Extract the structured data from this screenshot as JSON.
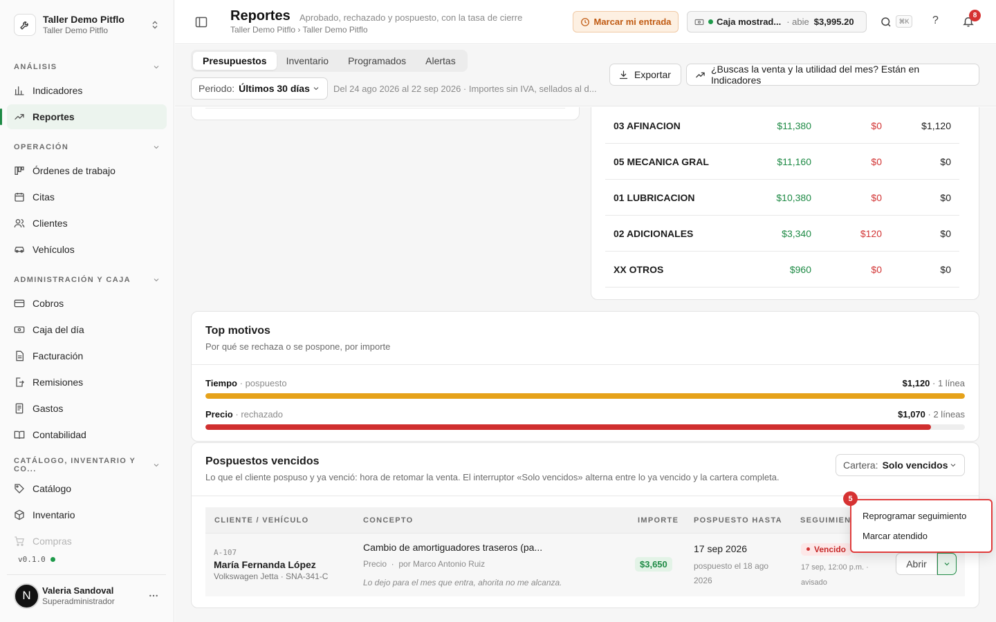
{
  "workspace": {
    "title": "Taller Demo Pitflo",
    "subtitle": "Taller Demo Pitflo"
  },
  "sidebar": {
    "sections": {
      "analisis": "ANÁLISIS",
      "operacion": "OPERACIÓN",
      "administracion": "ADMINISTRACIÓN Y CAJA",
      "catalogo": "CATÁLOGO, INVENTARIO Y CO..."
    },
    "items": {
      "indicadores": "Indicadores",
      "reportes": "Reportes",
      "ordenes": "Órdenes de trabajo",
      "citas": "Citas",
      "clientes": "Clientes",
      "vehiculos": "Vehículos",
      "cobros": "Cobros",
      "caja": "Caja del día",
      "facturacion": "Facturación",
      "remisiones": "Remisiones",
      "gastos": "Gastos",
      "contabilidad": "Contabilidad",
      "catalogo": "Catálogo",
      "inventario": "Inventario",
      "compras": "Compras"
    },
    "version": "v0.1.0",
    "user": {
      "initial": "N",
      "name": "Valeria Sandoval",
      "role": "Superadministrador"
    }
  },
  "header": {
    "title": "Reportes",
    "description": "Aprobado, rechazado y pospuesto, con la tasa de cierre",
    "breadcrumb": "Taller Demo Pitflo › Taller Demo Pitflo",
    "entrada_label": "Marcar mi entrada",
    "caja": {
      "name": "Caja mostrad...",
      "status": "abie",
      "amount": "$3,995.20"
    },
    "shortcut": "⌘K",
    "help": "?",
    "notifications": "8"
  },
  "toolbar": {
    "tabs": [
      "Presupuestos",
      "Inventario",
      "Programados",
      "Alertas"
    ],
    "periodo_label": "Periodo:",
    "periodo_value": "Últimos 30 días",
    "rango": "Del 24 ago 2026 al 22 sep 2026 · Importes sin IVA, sellados al d...",
    "exportar": "Exportar",
    "indicadores_hint": "¿Buscas la venta y la utilidad del mes? Están en Indicadores"
  },
  "categorias": [
    {
      "name": "03 AFINACION",
      "aprobado": "$11,380",
      "rechazado": "$0",
      "pospuesto": "$1,120"
    },
    {
      "name": "05 MECANICA GRAL",
      "aprobado": "$11,160",
      "rechazado": "$0",
      "pospuesto": "$0"
    },
    {
      "name": "01 LUBRICACION",
      "aprobado": "$10,380",
      "rechazado": "$0",
      "pospuesto": "$0"
    },
    {
      "name": "02 ADICIONALES",
      "aprobado": "$3,340",
      "rechazado": "$120",
      "pospuesto": "$0"
    },
    {
      "name": "XX OTROS",
      "aprobado": "$960",
      "rechazado": "$0",
      "pospuesto": "$0"
    }
  ],
  "motivos": {
    "title": "Top motivos",
    "subtitle": "Por qué se rechaza o se pospone, por importe",
    "items": [
      {
        "name": "Tiempo",
        "sep": " · ",
        "type": "pospuesto",
        "amount": "$1,120",
        "count": " · 1 línea",
        "share": 1.0,
        "color": "#e6a21a"
      },
      {
        "name": "Precio",
        "sep": " · ",
        "type": "rechazado",
        "amount": "$1,070",
        "count": " · 2 líneas",
        "share": 0.955,
        "color": "#d02f2f"
      }
    ]
  },
  "vencidos": {
    "title": "Pospuestos vencidos",
    "subtitle": "Lo que el cliente pospuso y ya venció: hora de retomar la venta. El interruptor «Solo vencidos» alterna entre lo ya vencido y la cartera completa.",
    "cartera_label": "Cartera:",
    "cartera_value": "Solo vencidos",
    "columns": [
      "CLIENTE / VEHÍCULO",
      "CONCEPTO",
      "IMPORTE",
      "POSPUESTO HASTA",
      "SEGUIMIENTO"
    ],
    "row": {
      "folio": "A-107",
      "cliente": "María Fernanda López",
      "vehiculo": "Volkswagen Jetta · SNA-341-C",
      "concepto": "Cambio de amortiguadores traseros (pa...",
      "motivo": "Precio",
      "por": "por Marco Antonio Ruiz",
      "nota": "Lo dejo para el mes que entra, ahorita no me alcanza.",
      "importe": "$3,650",
      "hasta": "17 sep 2026",
      "pospuesto_el": "pospuesto el 18 ago 2026",
      "estado": "Vencido",
      "seguimiento": "17 sep, 12:00 p.m. · avisado",
      "abrir": "Abrir"
    }
  },
  "menu": {
    "badge": "5",
    "items": [
      "Reprogramar seguimiento",
      "Marcar atendido"
    ]
  }
}
